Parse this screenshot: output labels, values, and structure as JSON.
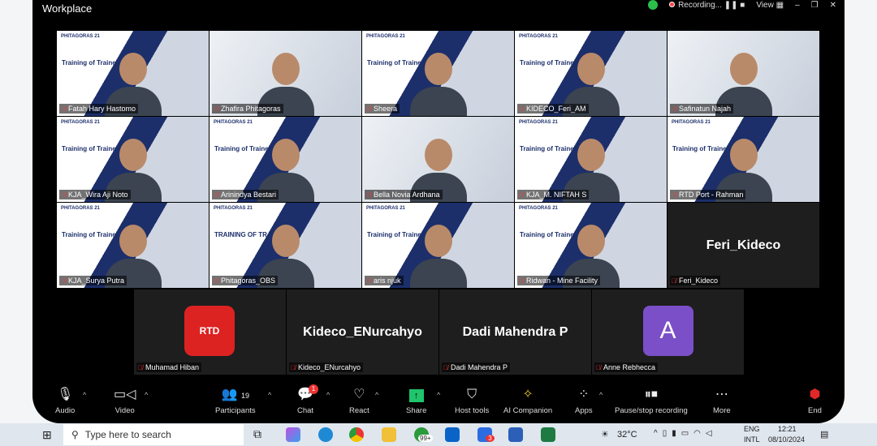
{
  "window": {
    "title": "Workplace",
    "recording": "Recording...",
    "view": "View"
  },
  "gallery": [
    {
      "name": "Fatah Hary Hastomo",
      "slide": "Training of Trainer"
    },
    {
      "name": "Zhafira Phitagoras",
      "active": true
    },
    {
      "name": "Sheera",
      "slide": "Training of Trainer"
    },
    {
      "name": "KIDECO_Feri_AM",
      "slide": "Training of Trainer"
    },
    {
      "name": "Safinatun Najah"
    },
    {
      "name": "KJA_Wira Aji Noto",
      "slide": "Training of Trainer"
    },
    {
      "name": "Arinindya Bestari",
      "slide": "Training of Trainer"
    },
    {
      "name": "Bella Novia Ardhana"
    },
    {
      "name": "KJA_M. NIFTAH S",
      "slide": "Training of Trainer"
    },
    {
      "name": "RTD Port - Rahman",
      "slide": "Training of Trainer"
    },
    {
      "name": "KJA_Surya Putra",
      "slide": "Training of Trainer"
    },
    {
      "name": "Phitagoras_OBS",
      "slide": "TRAINING OF TRAINER"
    },
    {
      "name": "aris njuk",
      "slide": "Training of Trainer"
    },
    {
      "name": "Ridwan - Mine Facility",
      "slide": "Training of Trainer"
    },
    {
      "name": "Feri_Kideco",
      "big": "Feri_Kideco"
    }
  ],
  "strip": [
    {
      "name": "Muhamad Hiban",
      "avatar": "RTD"
    },
    {
      "name": "Kideco_ENurcahyo",
      "big": "Kideco_ENurcahyo"
    },
    {
      "name": "Dadi Mahendra P",
      "big": "Dadi Mahendra P"
    },
    {
      "name": "Anne Rebhecca",
      "avatar": "A"
    }
  ],
  "toolbar": {
    "audio": "Audio",
    "video": "Video",
    "participants": "Participants",
    "participants_count": "19",
    "chat": "Chat",
    "chat_badge": "1",
    "react": "React",
    "share": "Share",
    "host_tools": "Host tools",
    "ai": "AI Companion",
    "apps": "Apps",
    "record": "Pause/stop recording",
    "more": "More",
    "end": "End"
  },
  "taskbar": {
    "search_placeholder": "Type here to search",
    "whatsapp_badge": "99+",
    "teams_badge": "3",
    "weather": "32°C",
    "lang1": "ENG",
    "lang2": "INTL",
    "time": "12:21",
    "date": "08/10/2024"
  },
  "colors": {
    "active_speaker": "#25d07a",
    "share": "#1fc46b",
    "end": "#e02828",
    "avatar_a": "#7b4fc7"
  }
}
